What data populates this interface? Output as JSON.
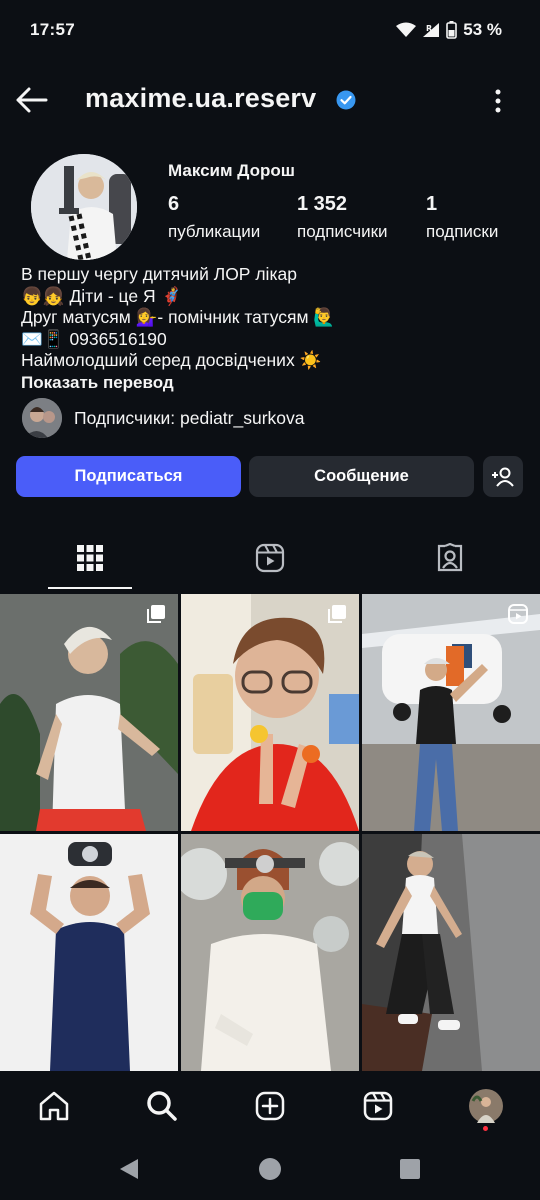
{
  "status_bar": {
    "time": "17:57",
    "battery": "53 %"
  },
  "header": {
    "username": "maxime.ua.reserv",
    "verified": true
  },
  "profile": {
    "full_name": "Максим Дорош",
    "stats": [
      {
        "value": "6",
        "label": "публикации"
      },
      {
        "value": "1 352",
        "label": "подписчики"
      },
      {
        "value": "1",
        "label": "подписки"
      }
    ],
    "bio_lines": [
      "В першу чергу дитячий ЛОР лікар",
      "👦👧 Діти - це Я 🦸",
      "Друг матусям 💁‍♀️- помічник татусям 🙋‍♂️",
      "✉️📱 0936516190",
      "Наймолодший серед досвідчених ☀️"
    ],
    "translate_label": "Показать перевод",
    "followed_by": "Подписчики: pediatr_surkova"
  },
  "actions": {
    "follow_label": "Подписаться",
    "message_label": "Сообщение"
  },
  "colors": {
    "background": "#0c0f14",
    "accent": "#4a5df9",
    "secondary_button": "#262a31",
    "verified": "#3897f0"
  },
  "tabs": [
    "grid-icon",
    "reels-icon",
    "tagged-icon"
  ],
  "posts": [
    {
      "description": "man in white tank top",
      "multi": true
    },
    {
      "description": "smiling man with finger puppets",
      "multi": true
    },
    {
      "description": "man near small airplane",
      "multi": false,
      "reel": true
    },
    {
      "description": "man in scrubs holding headlamp",
      "multi": false
    },
    {
      "description": "surgeon with green mask",
      "multi": false
    },
    {
      "description": "man in dark room with wide pants",
      "multi": false
    }
  ],
  "bottom_nav": [
    "home-icon",
    "search-icon",
    "create-icon",
    "reels-icon",
    "profile-avatar"
  ]
}
